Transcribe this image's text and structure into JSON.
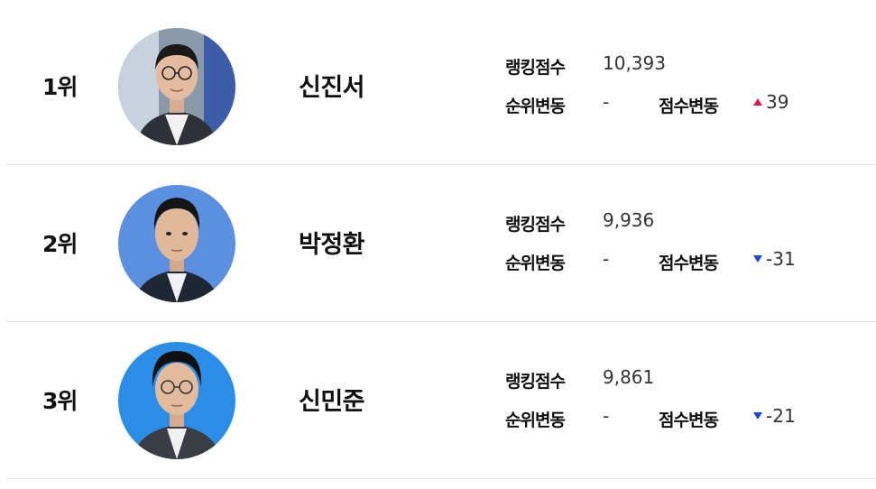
{
  "labels": {
    "ranking_score": "랭킹점수",
    "rank_change": "순위변동",
    "score_change": "점수변동"
  },
  "players": [
    {
      "rank": "1위",
      "name": "신진서",
      "ranking_score": "10,393",
      "rank_change": "-",
      "score_change": "39",
      "score_change_direction": "up",
      "photo_background": "#8a9aaa"
    },
    {
      "rank": "2위",
      "name": "박정환",
      "ranking_score": "9,936",
      "rank_change": "-",
      "score_change": "-31",
      "score_change_direction": "down",
      "photo_background": "#5b8fe0"
    },
    {
      "rank": "3위",
      "name": "신민준",
      "ranking_score": "9,861",
      "rank_change": "-",
      "score_change": "-21",
      "score_change_direction": "down",
      "photo_background": "#2a8ee8"
    }
  ],
  "colors": {
    "up": "#e2194b",
    "down": "#1a4be0",
    "divider": "#e6e6e6"
  }
}
